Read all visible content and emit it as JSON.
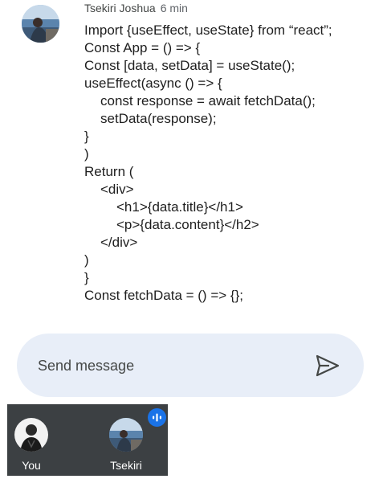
{
  "message": {
    "sender": "Tsekiri Joshua",
    "time": "6 min",
    "lines": [
      {
        "indent": 0,
        "text": "Import {useEffect, useState} from “react”;"
      },
      {
        "indent": 0,
        "text": "Const App = () => {"
      },
      {
        "indent": 0,
        "text": "Const [data, setData] = useState();"
      },
      {
        "indent": 0,
        "text": "useEffect(async () => {"
      },
      {
        "indent": 1,
        "text": "const response = await fetchData();"
      },
      {
        "indent": 1,
        "text": "setData(response);"
      },
      {
        "indent": 0,
        "text": "}"
      },
      {
        "indent": 0,
        "text": ")"
      },
      {
        "indent": 0,
        "text": "Return ("
      },
      {
        "indent": 1,
        "text": "<div>"
      },
      {
        "indent": 2,
        "text": "<h1>{data.title}</h1>"
      },
      {
        "indent": 2,
        "text": "<p>{data.content}</h2>"
      },
      {
        "indent": 1,
        "text": "</div>"
      },
      {
        "indent": 0,
        "text": ")"
      },
      {
        "indent": 0,
        "text": "}"
      },
      {
        "indent": 0,
        "text": "Const fetchData = () => {};"
      }
    ]
  },
  "composer": {
    "placeholder": "Send message",
    "send_icon": "send-icon"
  },
  "participants": [
    {
      "name": "You",
      "avatar_icon": "avatar-you"
    },
    {
      "name": "Tsekiri",
      "avatar_icon": "avatar-tsekiri",
      "speaking_icon": "audio-wave-icon"
    }
  ],
  "colors": {
    "composer_bg": "#e8eef8",
    "call_bar_bg": "#3c4043",
    "speaking_badge": "#1a73e8"
  }
}
